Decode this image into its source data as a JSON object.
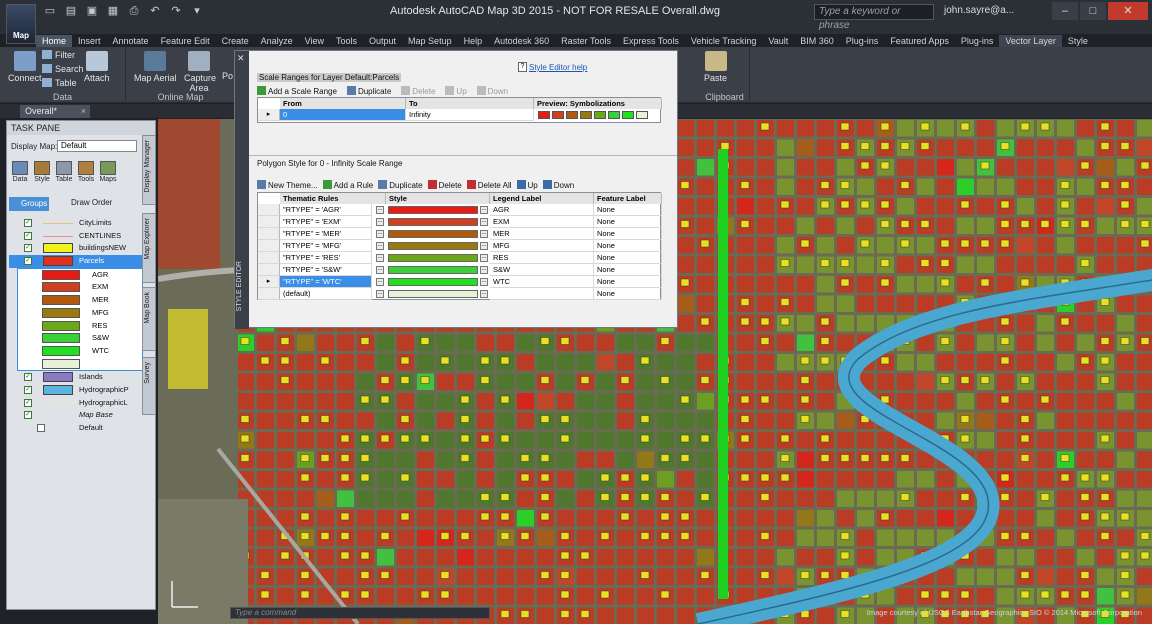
{
  "window": {
    "title": "Autodesk AutoCAD Map 3D 2015 - NOT FOR RESALE   Overall.dwg",
    "search_placeholder": "Type a keyword or phrase",
    "user": "john.sayre@a...",
    "logo": "Map"
  },
  "ribbon": {
    "tabs": [
      "Home",
      "Insert",
      "Annotate",
      "Feature Edit",
      "Create",
      "Analyze",
      "View",
      "Tools",
      "Output",
      "Map Setup",
      "Help",
      "Autodesk 360",
      "Raster Tools",
      "Express Tools",
      "Vehicle Tracking",
      "Vault",
      "BIM 360",
      "Plug-ins",
      "Featured Apps",
      "Plug-ins",
      "Vector Layer",
      "Style"
    ],
    "active_tab": "Home",
    "data_group": {
      "connect": "Connect",
      "filter": "Filter",
      "search": "Search",
      "table": "Table",
      "attach": "Attach",
      "label": "Data"
    },
    "online_map_group": {
      "map_aerial": "Map Aerial",
      "label": "Online Map"
    },
    "capture": "Capture Area",
    "po": "Po",
    "clipboard_group": {
      "paste": "Paste",
      "label": "Clipboard"
    }
  },
  "doc_tab": "Overall*",
  "task_pane": {
    "title": "TASK PANE",
    "display_map_label": "Display Map:",
    "display_map_value": "Default",
    "tools": [
      "Data",
      "Style",
      "Table",
      "Tools",
      "Maps"
    ],
    "groups_label": "Groups",
    "draw_order_label": "Draw Order",
    "side_tabs": [
      "Display Manager",
      "Map Explorer",
      "Map Book",
      "Survey"
    ],
    "layers": [
      {
        "name": "CityLimits",
        "color": "#e8c37a"
      },
      {
        "name": "CENTLINES",
        "color": "#e88c8c"
      },
      {
        "name": "buildingsNEW",
        "color": "#f2f21e"
      },
      {
        "name": "Parcels",
        "color": "#e03020"
      }
    ],
    "themes": [
      {
        "name": "AGR",
        "color": "#e81a12"
      },
      {
        "name": "EXM",
        "color": "#d04020"
      },
      {
        "name": "MER",
        "color": "#b05a10"
      },
      {
        "name": "MFG",
        "color": "#9a7a10"
      },
      {
        "name": "RES",
        "color": "#6aa81a"
      },
      {
        "name": "S&W",
        "color": "#3ad03a"
      },
      {
        "name": "WTC",
        "color": "#20e020"
      },
      {
        "name": "",
        "color": "#e8f2d8"
      }
    ],
    "layers_after": [
      {
        "name": "Islands",
        "color": "#8a78c0"
      },
      {
        "name": "HydrographicP",
        "color": "#5ab4e0"
      },
      {
        "name": "HydrographicL",
        "color": "#f0e8c0"
      }
    ],
    "map_base": "Map Base",
    "default_item": "Default"
  },
  "editor": {
    "help_link": "Style Editor help",
    "scale_title": "Scale Ranges for Layer Default:Parcels",
    "scale_toolbar": [
      "Add a Scale Range",
      "Duplicate",
      "Delete",
      "Up",
      "Down"
    ],
    "scale_columns": [
      "From",
      "To",
      "Preview: Symbolizations"
    ],
    "scale_row": {
      "from": "0",
      "to": "Infinity"
    },
    "preview_colors": [
      "#e81a12",
      "#d04020",
      "#b05a10",
      "#9a7a10",
      "#6aa81a",
      "#3ad03a",
      "#20e020",
      "#e8f2d8"
    ],
    "polygon_title": "Polygon Style for 0 - Infinity Scale Range",
    "rule_toolbar": [
      "New Theme...",
      "Add a Rule",
      "Duplicate",
      "Delete",
      "Delete All",
      "Up",
      "Down"
    ],
    "rule_columns": [
      "Thematic Rules",
      "Style",
      "Legend Label",
      "Feature Label"
    ],
    "rules": [
      {
        "rule": "\"RTYPE\" = 'AGR'",
        "color": "#e81a12",
        "legend": "AGR",
        "label": "None"
      },
      {
        "rule": "\"RTYPE\" = 'EXM'",
        "color": "#d04020",
        "legend": "EXM",
        "label": "None"
      },
      {
        "rule": "\"RTYPE\" = 'MER'",
        "color": "#b05a10",
        "legend": "MER",
        "label": "None"
      },
      {
        "rule": "\"RTYPE\" = 'MFG'",
        "color": "#9a7a10",
        "legend": "MFG",
        "label": "None"
      },
      {
        "rule": "\"RTYPE\" = 'RES'",
        "color": "#6aa81a",
        "legend": "RES",
        "label": "None"
      },
      {
        "rule": "\"RTYPE\" = 'S&W'",
        "color": "#3ad03a",
        "legend": "S&W",
        "label": "None"
      },
      {
        "rule": "\"RTYPE\" = 'WTC'",
        "color": "#20e020",
        "legend": "WTC",
        "label": "None"
      },
      {
        "rule": "(default)",
        "color": "#e8f2d8",
        "legend": "",
        "label": "None"
      }
    ],
    "strip_label": "STYLE EDITOR"
  },
  "command_line": "Type a command",
  "copyright": "Image courtesy of USGS Earthstar Geographics SIO © 2014 Microsoft Corporation"
}
